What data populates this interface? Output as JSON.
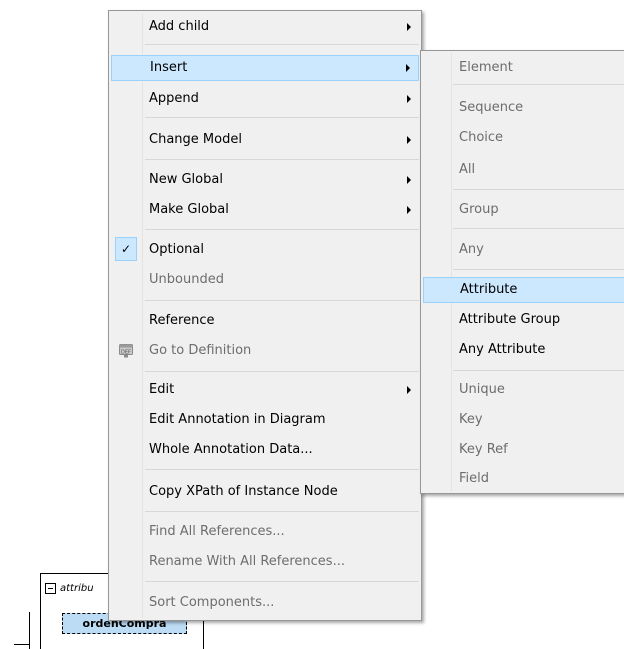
{
  "context_menu": {
    "items": [
      {
        "label": "Add child",
        "submenu": true,
        "enabled": true
      },
      {
        "label": "Insert",
        "submenu": true,
        "enabled": true,
        "highlighted": true
      },
      {
        "label": "Append",
        "submenu": true,
        "enabled": true
      },
      {
        "label": "Change Model",
        "submenu": true,
        "enabled": true
      },
      {
        "label": "New Global",
        "submenu": true,
        "enabled": true
      },
      {
        "label": "Make Global",
        "submenu": true,
        "enabled": true
      },
      {
        "label": "Optional",
        "checked": true,
        "enabled": true
      },
      {
        "label": "Unbounded",
        "enabled": false
      },
      {
        "label": "Reference",
        "enabled": true
      },
      {
        "label": "Go to Definition",
        "enabled": false,
        "icon": "go-to-definition-icon"
      },
      {
        "label": "Edit",
        "submenu": true,
        "enabled": true
      },
      {
        "label": "Edit Annotation in Diagram",
        "enabled": true
      },
      {
        "label": "Whole Annotation Data...",
        "enabled": true
      },
      {
        "label": "Copy XPath of Instance Node",
        "enabled": true
      },
      {
        "label": "Find All References...",
        "enabled": false
      },
      {
        "label": "Rename With All References...",
        "enabled": false
      },
      {
        "label": "Sort Components...",
        "enabled": false
      }
    ]
  },
  "insert_submenu": {
    "items": [
      {
        "label": "Element",
        "enabled": false
      },
      {
        "label": "Sequence",
        "enabled": false
      },
      {
        "label": "Choice",
        "enabled": false
      },
      {
        "label": "All",
        "enabled": false
      },
      {
        "label": "Group",
        "enabled": false
      },
      {
        "label": "Any",
        "enabled": false
      },
      {
        "label": "Attribute",
        "enabled": true,
        "highlighted": true
      },
      {
        "label": "Attribute Group",
        "enabled": true
      },
      {
        "label": "Any Attribute",
        "enabled": true
      },
      {
        "label": "Unique",
        "enabled": false
      },
      {
        "label": "Key",
        "enabled": false
      },
      {
        "label": "Key Ref",
        "enabled": false
      },
      {
        "label": "Field",
        "enabled": false
      }
    ]
  },
  "diagram": {
    "header_label": "attribu",
    "node_label": "ordenCompra"
  },
  "icons": {
    "checkmark": "✓",
    "go_to_definition": "DEF"
  },
  "colors": {
    "menu_bg": "#f0f0f0",
    "highlight_bg": "#cce8ff",
    "highlight_border": "#99d1ff",
    "disabled_text": "#6d6d6d",
    "node_fill": "#bcdcf5"
  }
}
